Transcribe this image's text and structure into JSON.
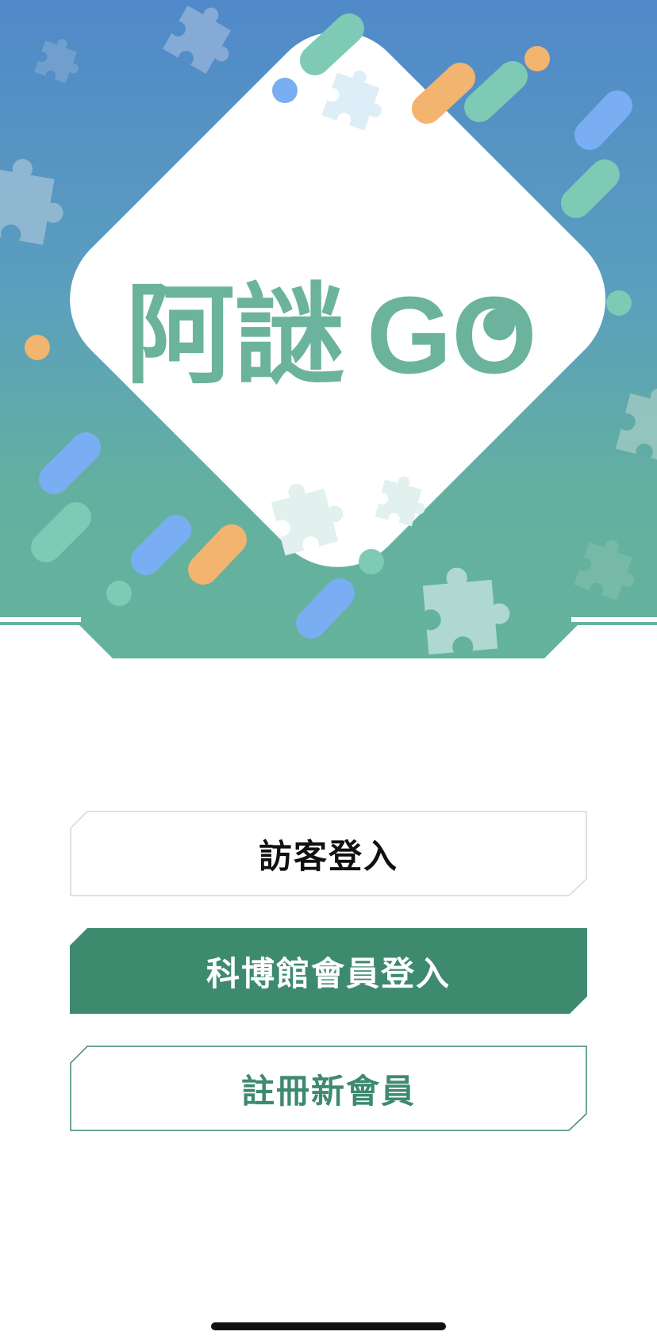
{
  "app": {
    "logo_text": "阿謎GO"
  },
  "buttons": {
    "guest_login": "訪客登入",
    "member_login": "科博館會員登入",
    "register": "註冊新會員"
  },
  "colors": {
    "sky_top": "#5089c9",
    "sky_bottom": "#65b39c",
    "brand_green": "#3d8a6f",
    "logo_green": "#6bb39c",
    "accent_orange": "#f2b46e",
    "accent_blue": "#7aaef2",
    "accent_mint": "#7ecab4"
  },
  "icons": {
    "puzzle": "puzzle-piece-icon"
  }
}
